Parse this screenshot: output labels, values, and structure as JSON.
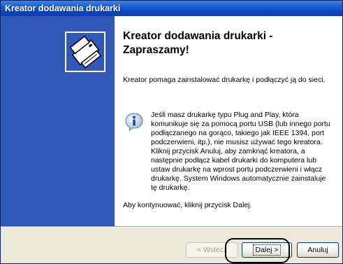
{
  "window": {
    "title": "Kreator dodawania drukarki"
  },
  "content": {
    "heading": "Kreator dodawania drukarki - Zapraszamy!",
    "intro": "Kreator pomaga zainstalować drukarkę i podłączyć ją do sieci.",
    "info_text": "Jeśli masz drukarkę typu Plug and Play, która komunikuje się za pomocą portu USB (lub innego portu podłączanego na gorąco, takiego jak IEEE 1394, port podczerwieni, itp.), nie musisz używać tego kreatora. Kliknij przycisk Anuluj, aby zamknąć kreatora, a następnie podłącz kabel drukarki do komputera lub ustaw drukarkę na wprost portu podczerwieni i włącz drukarkę. System Windows automatycznie zainstaluje tę drukarkę.",
    "continue_text": "Aby kontynuować, kliknij przycisk Dalej."
  },
  "buttons": {
    "back_label": "< Wstecz",
    "next_label": "Dalej >",
    "cancel_label": "Anuluj"
  },
  "icons": {
    "side_logo": "printer-icon",
    "info": "info-icon"
  },
  "colors": {
    "title_bar": "#0a47c4",
    "side_panel": "#2f58b9",
    "dialog_background": "#ece9d8",
    "highlight_ring": "#000000"
  }
}
